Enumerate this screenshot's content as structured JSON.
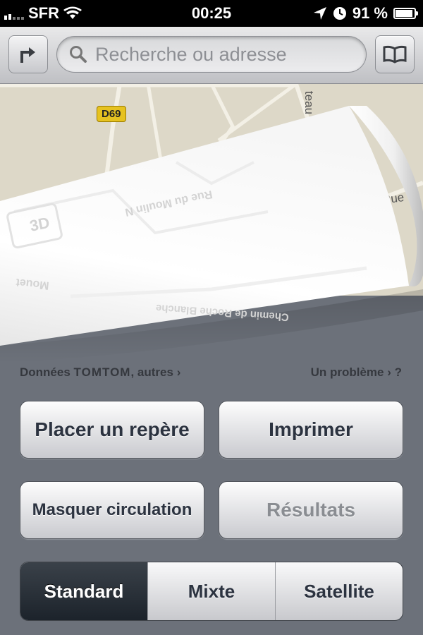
{
  "status_bar": {
    "carrier": "SFR",
    "time": "00:25",
    "battery_percent": "91 %"
  },
  "toolbar": {
    "directions_icon": "turn-arrow-icon",
    "search_placeholder": "Recherche ou adresse",
    "bookmarks_icon": "book-icon"
  },
  "map": {
    "road_label": "D69",
    "label_rue": "Rue d",
    "label_vertical": "teau",
    "flipped_labels": [
      "Rue du Moulin N",
      "3D",
      "Mouet",
      "Chemin de Roche Blanche"
    ]
  },
  "info": {
    "data_prefix": "Données",
    "brand": "TOMTOM",
    "data_suffix": ", autres",
    "problem": "Un problème",
    "help": "?"
  },
  "buttons": {
    "place_pin": "Placer un repère",
    "print": "Imprimer",
    "hide_traffic": "Masquer circulation",
    "results": "Résultats"
  },
  "map_type": {
    "options": [
      "Standard",
      "Mixte",
      "Satellite"
    ],
    "selected": "Standard"
  },
  "colors": {
    "map_bg": "#ddd8c8",
    "road_badge": "#e6c220",
    "selected_segment": "#232a32"
  }
}
